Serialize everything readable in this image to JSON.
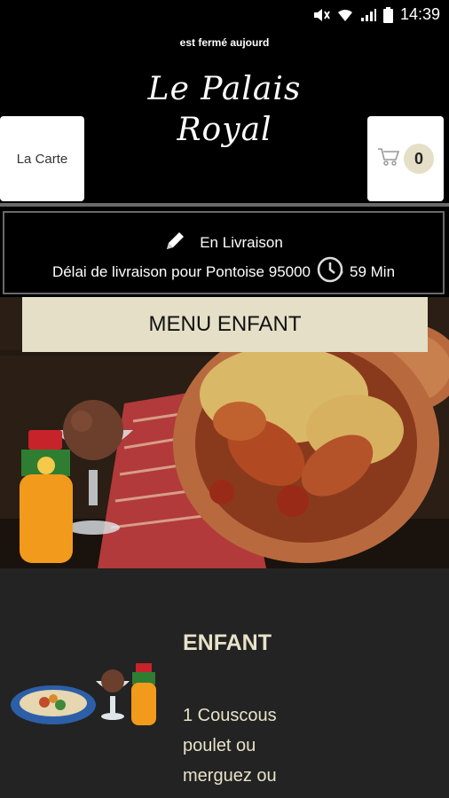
{
  "status_bar": {
    "time": "14:39"
  },
  "header": {
    "marquee_text": "est fermé aujourd",
    "logo_line1": "Le Palais",
    "logo_line2": "Royal",
    "carte_button_label": "La Carte",
    "cart_count": "0"
  },
  "delivery": {
    "mode": "En Livraison",
    "info": "Délai de livraison pour Pontoise 95000",
    "time": "59 Min"
  },
  "menu": {
    "banner_title": "MENU ENFANT",
    "category_title": "ENFANT",
    "category_description": "1 Couscous poulet ou merguez ou"
  },
  "colors": {
    "accent": "#e4dfc6",
    "background": "#000000",
    "panel": "#232323",
    "text_light": "#e8e2c9"
  }
}
